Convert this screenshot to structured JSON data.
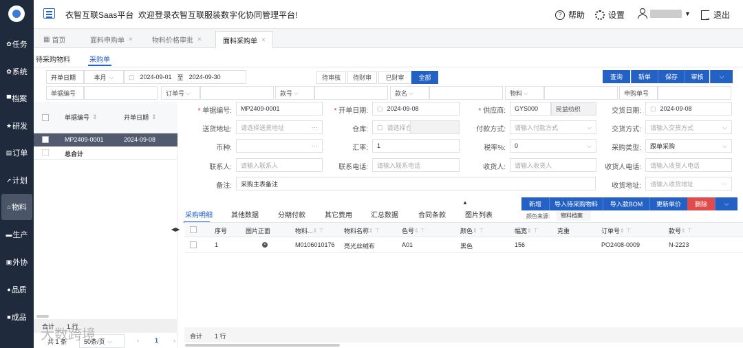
{
  "sidebar": {
    "items": [
      {
        "label": "任务",
        "icon": "gear-icon"
      },
      {
        "label": "系统",
        "icon": "gear-icon"
      },
      {
        "label": "档案",
        "icon": "folder-icon"
      },
      {
        "label": "研发",
        "icon": "star-icon"
      },
      {
        "label": "订单",
        "icon": "doc-icon"
      },
      {
        "label": "计划",
        "icon": "send-icon"
      },
      {
        "label": "物料",
        "icon": "home-icon"
      },
      {
        "label": "生产",
        "icon": "factory-icon"
      },
      {
        "label": "外协",
        "icon": "monitor-icon"
      },
      {
        "label": "品质",
        "icon": "check-icon"
      },
      {
        "label": "成品",
        "icon": "box-icon"
      }
    ]
  },
  "header": {
    "platform": "衣智互联Saas平台",
    "welcome": "欢迎登录衣智互联服装数字化协同管理平台!",
    "help": "帮助",
    "settings": "设置",
    "logout": "退出"
  },
  "tabs": [
    {
      "label": "首页"
    },
    {
      "label": "面料申购单"
    },
    {
      "label": "物料价格审批"
    },
    {
      "label": "面料采购单"
    }
  ],
  "subtabs": [
    "待采购物料",
    "采购单"
  ],
  "filter": {
    "date_label": "开单日期",
    "period": "本月",
    "date_from": "2024-09-01",
    "to": "至",
    "date_to": "2024-09-30",
    "statuses": [
      "待审核",
      "待财审",
      "已财审",
      "全部"
    ],
    "fields": [
      "单据编号",
      "订单号",
      "款号",
      "款名",
      "物料",
      "申购单号"
    ]
  },
  "actions": [
    "查询",
    "新单",
    "保存",
    "审核"
  ],
  "list": {
    "headers": [
      "单据编号",
      "开单日期"
    ],
    "rows": [
      {
        "no": "MP2409-0001",
        "date": "2024-09-08"
      }
    ],
    "total": "总合计",
    "footer_total": "合计",
    "footer_rows": "1 行",
    "pager": {
      "total": "共 1 条",
      "size": "50条/页",
      "page": "1"
    }
  },
  "form": {
    "doc_no": {
      "label": "单据编号:",
      "value": "MP2409-0001"
    },
    "open_date": {
      "label": "开单日期:",
      "value": "2024-09-08"
    },
    "supplier": {
      "label": "供应商:",
      "code": "GYS000",
      "name": "民益纺织"
    },
    "delivery_date": {
      "label": "交货日期:",
      "value": "2024-09-08"
    },
    "ship_addr": {
      "label": "送货地址:",
      "placeholder": "请选择送货地址"
    },
    "warehouse": {
      "label": "仓库:",
      "placeholder": "请选择仓"
    },
    "payment": {
      "label": "付款方式:",
      "placeholder": "请输入付款方式"
    },
    "delivery_mode": {
      "label": "交货方式:",
      "placeholder": "请输入交货方式"
    },
    "currency": {
      "label": "币种:"
    },
    "rate": {
      "label": "汇率:",
      "value": "1"
    },
    "tax": {
      "label": "税率%:",
      "value": "0"
    },
    "ptype": {
      "label": "采购类型:",
      "value": "跟单采购"
    },
    "contact": {
      "label": "联系人:",
      "placeholder": "请输入联系人"
    },
    "phone": {
      "label": "联系电话:",
      "placeholder": "请输入联系电话"
    },
    "receiver": {
      "label": "收货人:",
      "placeholder": "请输入收货人"
    },
    "receiver_phone": {
      "label": "收货人电话:",
      "placeholder": "请输入收货人电话"
    },
    "remark": {
      "label": "备注:",
      "value": "采购主表备注"
    },
    "recv_addr": {
      "label": "收货地址:",
      "placeholder": "请输入收货地址"
    }
  },
  "detail_tabs": [
    "采购明细",
    "其他数据",
    "分期付款",
    "其它费用",
    "汇总数据",
    "合同条款",
    "图片列表"
  ],
  "detail_actions": [
    "新增",
    "导入待采购物料",
    "导入款BOM",
    "更新单价",
    "删除"
  ],
  "color_source": {
    "label": "颜色来源:",
    "value": "物料档案"
  },
  "detail": {
    "headers": [
      "序号",
      "图片正面",
      "物料...",
      "物料名称",
      "色号",
      "颜色",
      "幅宽",
      "克重",
      "订单号",
      "款号"
    ],
    "rows": [
      {
        "seq": "1",
        "code": "M0106010176",
        "name": "亮光丝绒布",
        "colorno": "A01",
        "color": "黑色",
        "width": "156",
        "weight": "",
        "order": "PO2408-0009",
        "style": "N-2223"
      }
    ],
    "footer_total": "合计",
    "footer_rows": "1 行"
  },
  "watermark": "大数跨境",
  "colors": {
    "sidebar": "#1f2a3d",
    "primary": "#2461c5",
    "delete": "#e04b4b"
  }
}
